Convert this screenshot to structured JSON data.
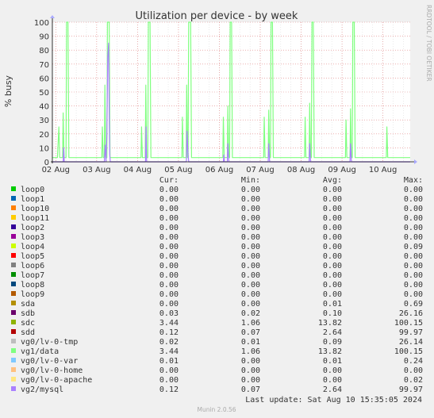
{
  "chart_data": {
    "type": "line",
    "title": "Utilization per device - by week",
    "ylabel": "% busy",
    "xlabel": "",
    "ylim": [
      0,
      100
    ],
    "yticks": [
      0,
      10,
      20,
      30,
      40,
      50,
      60,
      70,
      80,
      90,
      100
    ],
    "xlim": [
      "2024-08-01T22:00",
      "2024-08-10T16:00"
    ],
    "xticks": [
      {
        "label": "02 Aug",
        "t": "2024-08-02T00:00"
      },
      {
        "label": "03 Aug",
        "t": "2024-08-03T00:00"
      },
      {
        "label": "04 Aug",
        "t": "2024-08-04T00:00"
      },
      {
        "label": "05 Aug",
        "t": "2024-08-05T00:00"
      },
      {
        "label": "06 Aug",
        "t": "2024-08-06T00:00"
      },
      {
        "label": "07 Aug",
        "t": "2024-08-07T00:00"
      },
      {
        "label": "08 Aug",
        "t": "2024-08-08T00:00"
      },
      {
        "label": "09 Aug",
        "t": "2024-08-09T00:00"
      },
      {
        "label": "10 Aug",
        "t": "2024-08-10T00:00"
      }
    ],
    "grid": true,
    "side_label": "RRDTOOL / TOBI OETIKER",
    "columns": [
      "Cur:",
      "Min:",
      "Avg:",
      "Max:"
    ],
    "series": [
      {
        "name": "loop0",
        "color": "#00cc00",
        "cur": "0.00",
        "min": "0.00",
        "avg": "0.00",
        "max": "0.00"
      },
      {
        "name": "loop1",
        "color": "#0066b3",
        "cur": "0.00",
        "min": "0.00",
        "avg": "0.00",
        "max": "0.00"
      },
      {
        "name": "loop10",
        "color": "#ff8000",
        "cur": "0.00",
        "min": "0.00",
        "avg": "0.00",
        "max": "0.00"
      },
      {
        "name": "loop11",
        "color": "#ffcc00",
        "cur": "0.00",
        "min": "0.00",
        "avg": "0.00",
        "max": "0.00"
      },
      {
        "name": "loop2",
        "color": "#330099",
        "cur": "0.00",
        "min": "0.00",
        "avg": "0.00",
        "max": "0.00"
      },
      {
        "name": "loop3",
        "color": "#990099",
        "cur": "0.00",
        "min": "0.00",
        "avg": "0.00",
        "max": "0.00"
      },
      {
        "name": "loop4",
        "color": "#ccff00",
        "cur": "0.00",
        "min": "0.00",
        "avg": "0.00",
        "max": "0.09"
      },
      {
        "name": "loop5",
        "color": "#ff0000",
        "cur": "0.00",
        "min": "0.00",
        "avg": "0.00",
        "max": "0.00"
      },
      {
        "name": "loop6",
        "color": "#808080",
        "cur": "0.00",
        "min": "0.00",
        "avg": "0.00",
        "max": "0.00"
      },
      {
        "name": "loop7",
        "color": "#008f00",
        "cur": "0.00",
        "min": "0.00",
        "avg": "0.00",
        "max": "0.00"
      },
      {
        "name": "loop8",
        "color": "#00487d",
        "cur": "0.00",
        "min": "0.00",
        "avg": "0.00",
        "max": "0.00"
      },
      {
        "name": "loop9",
        "color": "#b35a00",
        "cur": "0.00",
        "min": "0.00",
        "avg": "0.00",
        "max": "0.00"
      },
      {
        "name": "sda",
        "color": "#b38f00",
        "cur": "0.00",
        "min": "0.00",
        "avg": "0.01",
        "max": "0.69"
      },
      {
        "name": "sdb",
        "color": "#6b006b",
        "cur": "0.03",
        "min": "0.02",
        "avg": "0.10",
        "max": "26.16"
      },
      {
        "name": "sdc",
        "color": "#8fb300",
        "cur": "3.44",
        "min": "1.06",
        "avg": "13.82",
        "max": "100.15"
      },
      {
        "name": "sdd",
        "color": "#b30000",
        "cur": "0.12",
        "min": "0.07",
        "avg": "2.64",
        "max": "99.97"
      },
      {
        "name": "vg0/lv-0-tmp",
        "color": "#bebebe",
        "cur": "0.02",
        "min": "0.01",
        "avg": "0.09",
        "max": "26.14"
      },
      {
        "name": "vg1/data",
        "color": "#80ff80",
        "cur": "3.44",
        "min": "1.06",
        "avg": "13.82",
        "max": "100.15"
      },
      {
        "name": "vg0/lv-0-var",
        "color": "#80c9ff",
        "cur": "0.01",
        "min": "0.00",
        "avg": "0.01",
        "max": "0.24"
      },
      {
        "name": "vg0/lv-0-home",
        "color": "#ffc080",
        "cur": "0.00",
        "min": "0.00",
        "avg": "0.00",
        "max": "0.00"
      },
      {
        "name": "vg0/lv-0-apache",
        "color": "#ffe680",
        "cur": "0.00",
        "min": "0.00",
        "avg": "0.00",
        "max": "0.02"
      },
      {
        "name": "vg2/mysql",
        "color": "#aa80ff",
        "cur": "0.12",
        "min": "0.07",
        "avg": "2.64",
        "max": "99.97"
      }
    ],
    "plotted": [
      {
        "name": "vg1/data",
        "color": "#80ff80",
        "points": [
          [
            "2024-08-01T22:00",
            3
          ],
          [
            "2024-08-02T01:00",
            3
          ],
          [
            "2024-08-02T01:50",
            25
          ],
          [
            "2024-08-02T02:20",
            3
          ],
          [
            "2024-08-02T04:00",
            3
          ],
          [
            "2024-08-02T04:20",
            35
          ],
          [
            "2024-08-02T04:50",
            3
          ],
          [
            "2024-08-02T06:00",
            3
          ],
          [
            "2024-08-02T06:20",
            100
          ],
          [
            "2024-08-02T07:10",
            100
          ],
          [
            "2024-08-02T07:40",
            3
          ],
          [
            "2024-08-02T12:00",
            3
          ],
          [
            "2024-08-02T17:00",
            3
          ],
          [
            "2024-08-03T00:00",
            3
          ],
          [
            "2024-08-03T03:00",
            3
          ],
          [
            "2024-08-03T03:20",
            25
          ],
          [
            "2024-08-03T03:50",
            3
          ],
          [
            "2024-08-03T04:30",
            3
          ],
          [
            "2024-08-03T04:50",
            55
          ],
          [
            "2024-08-03T05:20",
            3
          ],
          [
            "2024-08-03T06:00",
            3
          ],
          [
            "2024-08-03T06:20",
            100
          ],
          [
            "2024-08-03T07:20",
            100
          ],
          [
            "2024-08-03T07:50",
            3
          ],
          [
            "2024-08-03T14:00",
            3
          ],
          [
            "2024-08-04T02:00",
            3
          ],
          [
            "2024-08-04T02:20",
            25
          ],
          [
            "2024-08-04T02:50",
            3
          ],
          [
            "2024-08-04T04:30",
            3
          ],
          [
            "2024-08-04T04:50",
            55
          ],
          [
            "2024-08-04T05:20",
            3
          ],
          [
            "2024-08-04T06:00",
            3
          ],
          [
            "2024-08-04T06:20",
            100
          ],
          [
            "2024-08-04T07:20",
            100
          ],
          [
            "2024-08-04T07:50",
            3
          ],
          [
            "2024-08-04T18:00",
            3
          ],
          [
            "2024-08-05T02:00",
            3
          ],
          [
            "2024-08-05T02:20",
            32
          ],
          [
            "2024-08-05T02:50",
            3
          ],
          [
            "2024-08-05T04:30",
            3
          ],
          [
            "2024-08-05T04:50",
            55
          ],
          [
            "2024-08-05T05:20",
            3
          ],
          [
            "2024-08-05T05:40",
            3
          ],
          [
            "2024-08-05T06:00",
            100
          ],
          [
            "2024-08-05T07:10",
            100
          ],
          [
            "2024-08-05T07:40",
            3
          ],
          [
            "2024-08-05T16:00",
            3
          ],
          [
            "2024-08-06T02:00",
            3
          ],
          [
            "2024-08-06T02:20",
            32
          ],
          [
            "2024-08-06T02:50",
            3
          ],
          [
            "2024-08-06T04:40",
            3
          ],
          [
            "2024-08-06T05:00",
            40
          ],
          [
            "2024-08-06T05:30",
            3
          ],
          [
            "2024-08-06T06:00",
            3
          ],
          [
            "2024-08-06T06:20",
            100
          ],
          [
            "2024-08-06T07:10",
            100
          ],
          [
            "2024-08-06T07:40",
            3
          ],
          [
            "2024-08-06T18:00",
            3
          ],
          [
            "2024-08-07T02:00",
            3
          ],
          [
            "2024-08-07T02:20",
            32
          ],
          [
            "2024-08-07T02:50",
            3
          ],
          [
            "2024-08-07T04:40",
            3
          ],
          [
            "2024-08-07T05:00",
            37
          ],
          [
            "2024-08-07T05:30",
            3
          ],
          [
            "2024-08-07T06:00",
            3
          ],
          [
            "2024-08-07T06:20",
            100
          ],
          [
            "2024-08-07T07:10",
            100
          ],
          [
            "2024-08-07T07:40",
            3
          ],
          [
            "2024-08-07T20:00",
            3
          ],
          [
            "2024-08-08T02:00",
            3
          ],
          [
            "2024-08-08T02:20",
            32
          ],
          [
            "2024-08-08T02:50",
            3
          ],
          [
            "2024-08-08T04:40",
            3
          ],
          [
            "2024-08-08T05:00",
            42
          ],
          [
            "2024-08-08T05:30",
            3
          ],
          [
            "2024-08-08T06:00",
            3
          ],
          [
            "2024-08-08T06:20",
            100
          ],
          [
            "2024-08-08T07:10",
            100
          ],
          [
            "2024-08-08T07:40",
            3
          ],
          [
            "2024-08-08T18:00",
            3
          ],
          [
            "2024-08-09T02:00",
            3
          ],
          [
            "2024-08-09T02:20",
            30
          ],
          [
            "2024-08-09T02:50",
            3
          ],
          [
            "2024-08-09T04:40",
            3
          ],
          [
            "2024-08-09T05:00",
            38
          ],
          [
            "2024-08-09T05:30",
            3
          ],
          [
            "2024-08-09T06:00",
            3
          ],
          [
            "2024-08-09T06:20",
            100
          ],
          [
            "2024-08-09T07:10",
            100
          ],
          [
            "2024-08-09T07:40",
            3
          ],
          [
            "2024-08-09T20:00",
            3
          ],
          [
            "2024-08-10T02:00",
            3
          ],
          [
            "2024-08-10T02:20",
            25
          ],
          [
            "2024-08-10T02:50",
            3
          ],
          [
            "2024-08-10T16:00",
            3
          ]
        ]
      },
      {
        "name": "vg2/mysql",
        "color": "#aa80ff",
        "points": [
          [
            "2024-08-01T22:00",
            0
          ],
          [
            "2024-08-02T04:20",
            0
          ],
          [
            "2024-08-02T04:40",
            10
          ],
          [
            "2024-08-02T05:00",
            0
          ],
          [
            "2024-08-02T12:00",
            0
          ],
          [
            "2024-08-03T04:30",
            0
          ],
          [
            "2024-08-03T05:00",
            12
          ],
          [
            "2024-08-03T05:30",
            0
          ],
          [
            "2024-08-03T06:00",
            20
          ],
          [
            "2024-08-03T06:30",
            75
          ],
          [
            "2024-08-03T07:00",
            85
          ],
          [
            "2024-08-03T07:20",
            40
          ],
          [
            "2024-08-03T07:40",
            5
          ],
          [
            "2024-08-03T08:00",
            0
          ],
          [
            "2024-08-04T04:40",
            0
          ],
          [
            "2024-08-04T05:00",
            25
          ],
          [
            "2024-08-04T05:20",
            0
          ],
          [
            "2024-08-05T04:40",
            0
          ],
          [
            "2024-08-05T05:00",
            22
          ],
          [
            "2024-08-05T05:30",
            8
          ],
          [
            "2024-08-05T06:00",
            0
          ],
          [
            "2024-08-06T02:20",
            0
          ],
          [
            "2024-08-06T02:40",
            5
          ],
          [
            "2024-08-06T03:00",
            0
          ],
          [
            "2024-08-06T04:40",
            0
          ],
          [
            "2024-08-06T05:00",
            13
          ],
          [
            "2024-08-06T05:30",
            0
          ],
          [
            "2024-08-07T04:40",
            0
          ],
          [
            "2024-08-07T05:00",
            13
          ],
          [
            "2024-08-07T05:30",
            0
          ],
          [
            "2024-08-08T04:40",
            0
          ],
          [
            "2024-08-08T05:00",
            13
          ],
          [
            "2024-08-08T05:30",
            0
          ],
          [
            "2024-08-09T04:40",
            0
          ],
          [
            "2024-08-09T05:00",
            13
          ],
          [
            "2024-08-09T05:30",
            0
          ],
          [
            "2024-08-10T16:00",
            0
          ]
        ]
      }
    ]
  },
  "footer": {
    "last_update": "Last update: Sat Aug 10 15:35:05 2024",
    "version": "Munin 2.0.56"
  }
}
